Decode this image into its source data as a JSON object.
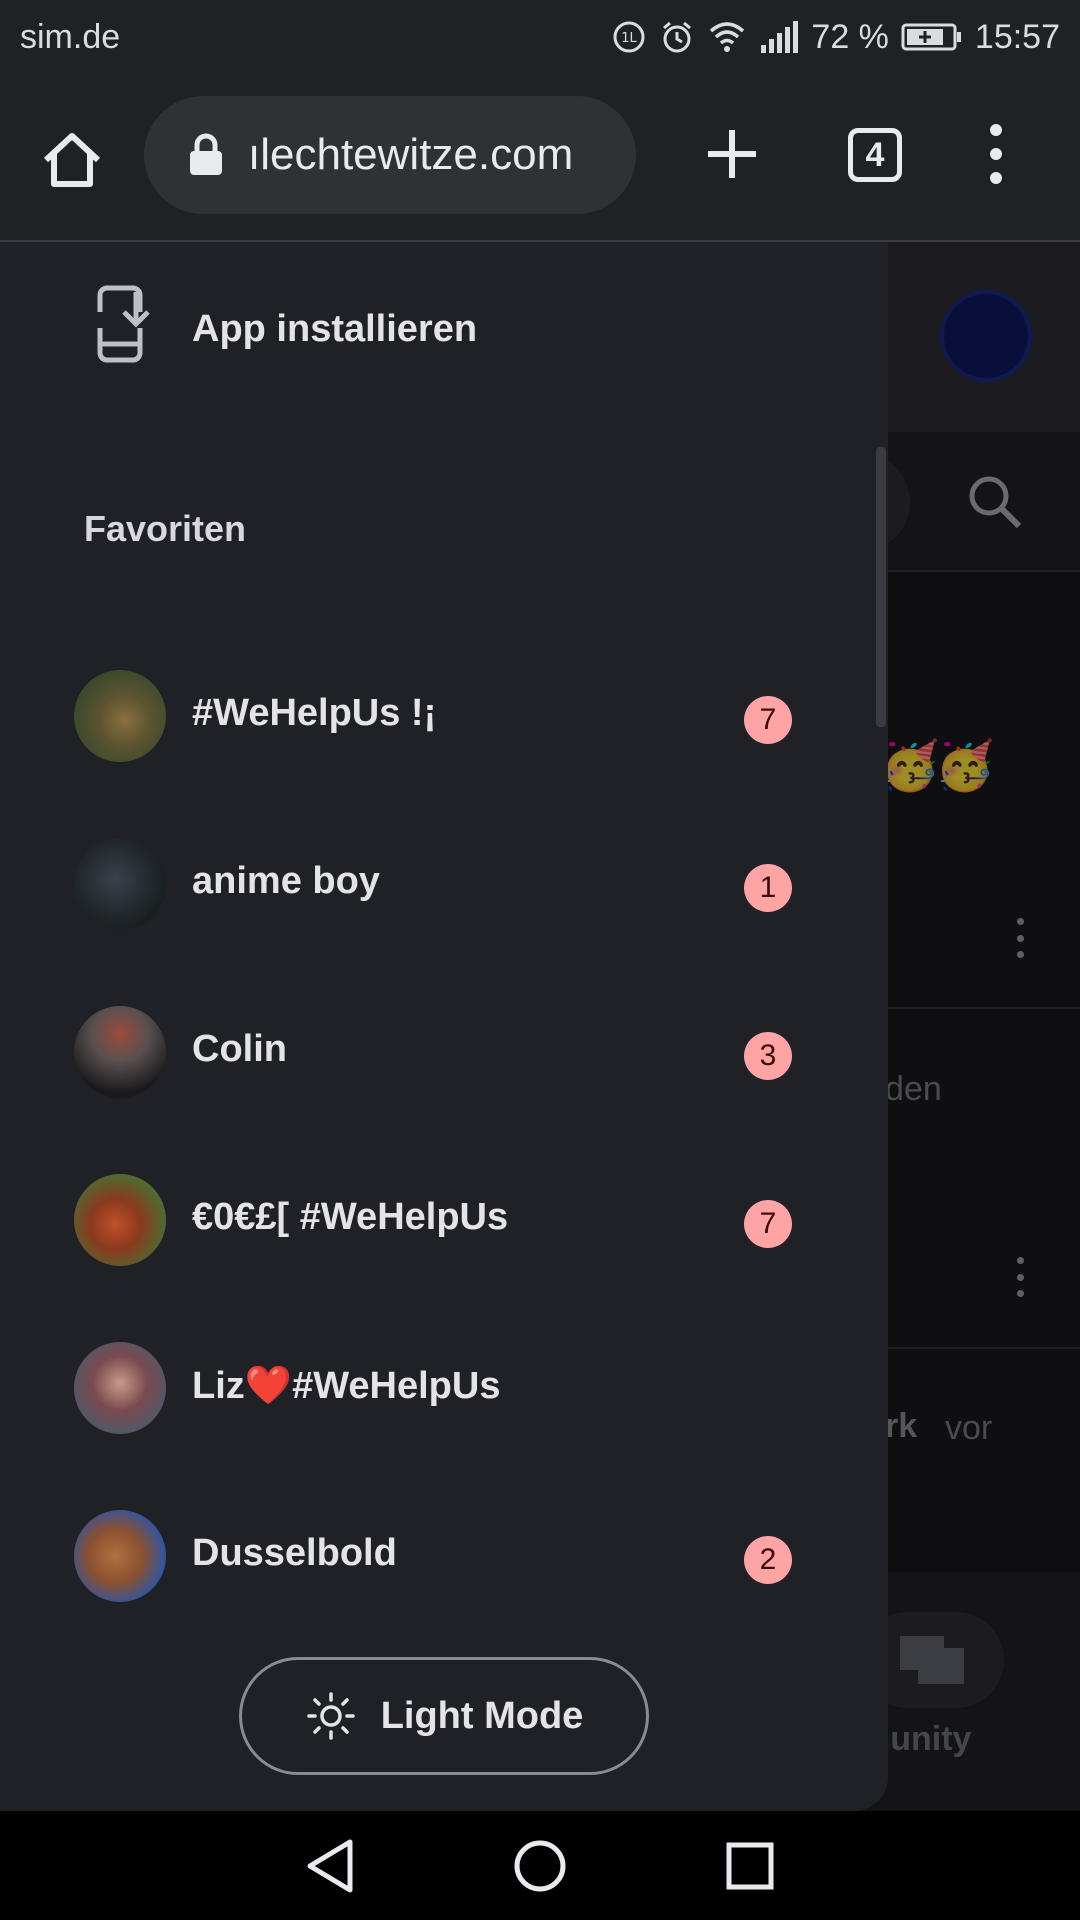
{
  "status_bar": {
    "carrier": "sim.de",
    "battery": "72 %",
    "time": "15:57"
  },
  "browser": {
    "url": "ılechtewitze.com",
    "tab_count": "4"
  },
  "background": {
    "text_1": "den",
    "text_2": "rk",
    "text_3": "vor",
    "community_label": "munity"
  },
  "drawer": {
    "install_label": "App installieren",
    "favorites_title": "Favoriten",
    "favorites": [
      {
        "name": "#WeHelpUs !¡",
        "badge": "7"
      },
      {
        "name": "anime boy",
        "badge": "1"
      },
      {
        "name": "Colin",
        "badge": "3"
      },
      {
        "name": "€0€£[ #WeHelpUs",
        "badge": "7"
      },
      {
        "name": "Liz❤️#WeHelpUs",
        "badge": ""
      },
      {
        "name": "Dusselbold",
        "badge": "2"
      }
    ],
    "light_mode_label": "Light Mode"
  },
  "colors": {
    "drawer_bg": "#202126",
    "badge_bg": "#ffa4a4",
    "toolbar_bg": "#202124"
  }
}
